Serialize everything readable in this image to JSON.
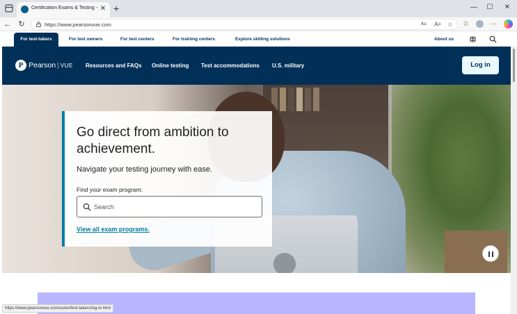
{
  "browser": {
    "tab_title": "Certification Exams & Testing - P",
    "tab_close": "✕",
    "new_tab": "+",
    "url": "https://www.pearsonvue.com",
    "status_url": "https://www.pearsonvue.com/us/en/test-takers/log-in.html",
    "window_controls": {
      "minimize": "—",
      "maximize": "☐",
      "close": "✕"
    },
    "nav": {
      "back": "←",
      "refresh": "↻"
    },
    "toolbar_glyphs": {
      "read_aloud": "ᴬᵃ",
      "text_format": "Aᵃ",
      "favorite": "☆",
      "favorites": "☆",
      "more": "···"
    }
  },
  "utility_nav": {
    "items": [
      {
        "label": "For test-takers",
        "active": true
      },
      {
        "label": "For test owners",
        "active": false
      },
      {
        "label": "For test centers",
        "active": false
      },
      {
        "label": "For training centers",
        "active": false
      },
      {
        "label": "Explore skilling solutions",
        "active": false
      }
    ],
    "about": "About us",
    "icons": [
      "globe-icon",
      "search-icon"
    ]
  },
  "header": {
    "logo_letter": "P",
    "logo_name": "Pearson",
    "logo_sep": "|",
    "logo_sub": "VUE",
    "nav": [
      "Resources and FAQs",
      "Online testing",
      "Test accommodations",
      "U.S. military"
    ],
    "login": "Log in"
  },
  "hero": {
    "headline": "Go direct from ambition to achievement.",
    "subhead": "Navigate your testing journey with ease.",
    "find_label": "Find your exam program:",
    "search_placeholder": "Search",
    "view_all": "View all exam programs."
  },
  "colors": {
    "navy": "#003057",
    "teal": "#007fa3",
    "login_bg": "#e8f8fb",
    "promo": "#b9b5ff"
  }
}
